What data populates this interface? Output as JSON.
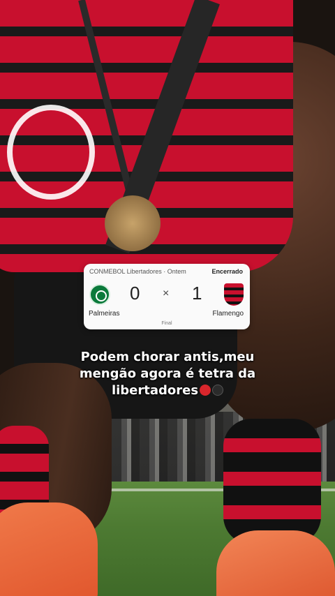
{
  "score_card": {
    "league": "CONMEBOL Libertadores · Ontem",
    "status": "Encerrado",
    "home_team": "Palmeiras",
    "away_team": "Flamengo",
    "home_score": "0",
    "away_score": "1",
    "separator": "×",
    "note": "Final"
  },
  "caption": {
    "line1": "Podem chorar antis,meu",
    "line2": "mengão agora é tetra da",
    "line3": "libertadores",
    "emoji": [
      "red-circle",
      "black-circle"
    ]
  },
  "colors": {
    "flamengo_red": "#c8102e",
    "palmeiras_green": "#0b7a3b",
    "card_bg": "#fafafa"
  }
}
